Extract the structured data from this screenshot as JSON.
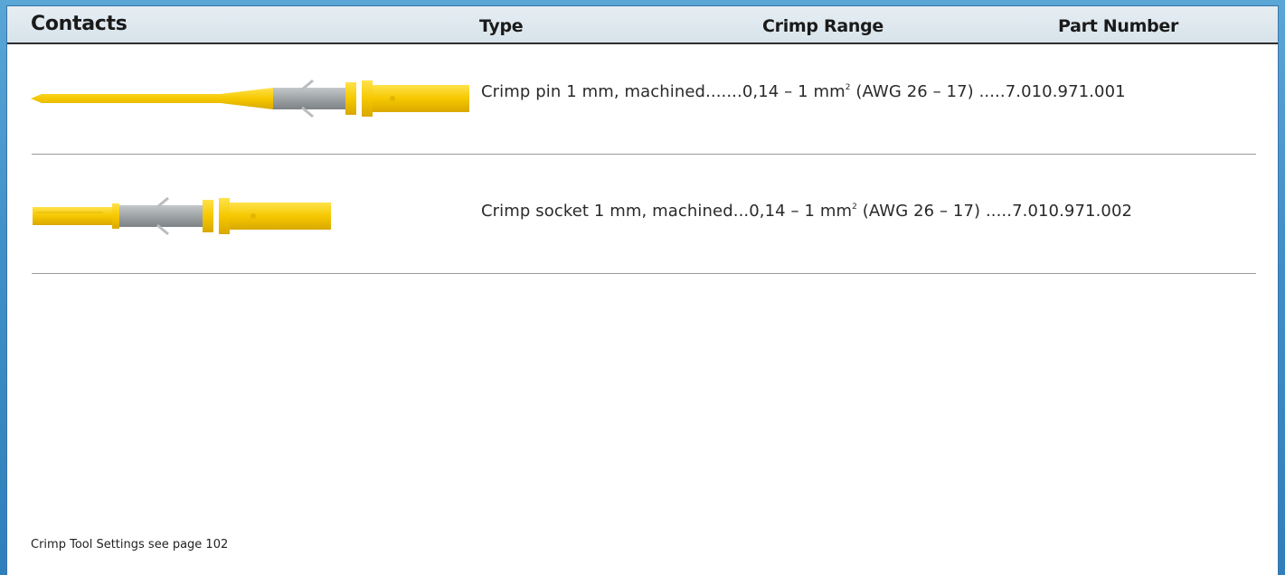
{
  "header": {
    "title": "Contacts",
    "columns": {
      "type": "Type",
      "crimp_range": "Crimp Range",
      "part_number": "Part Number"
    }
  },
  "rows": [
    {
      "type": "Crimp pin 1 mm, machined",
      "leader1": ".......",
      "crimp_range": "0,14 – 1 mm",
      "superscript": "2",
      "awg": " (AWG 26 – 17) ",
      "leader2": ".....",
      "part_number": "7.010.971.001",
      "image": "crimp-pin"
    },
    {
      "type": "Crimp socket 1 mm, machined",
      "leader1": "...",
      "crimp_range": "0,14 – 1 mm",
      "superscript": "2",
      "awg": " (AWG 26 – 17) ",
      "leader2": ".....",
      "part_number": "7.010.971.002",
      "image": "crimp-socket"
    }
  ],
  "footnote": "Crimp Tool Settings see page 102",
  "colors": {
    "contact_yellow": "#f5c800",
    "insulation_grey": "#9ea3a6",
    "header_bg": "#dde7ed",
    "frame_blue": "#3f8fc8"
  }
}
